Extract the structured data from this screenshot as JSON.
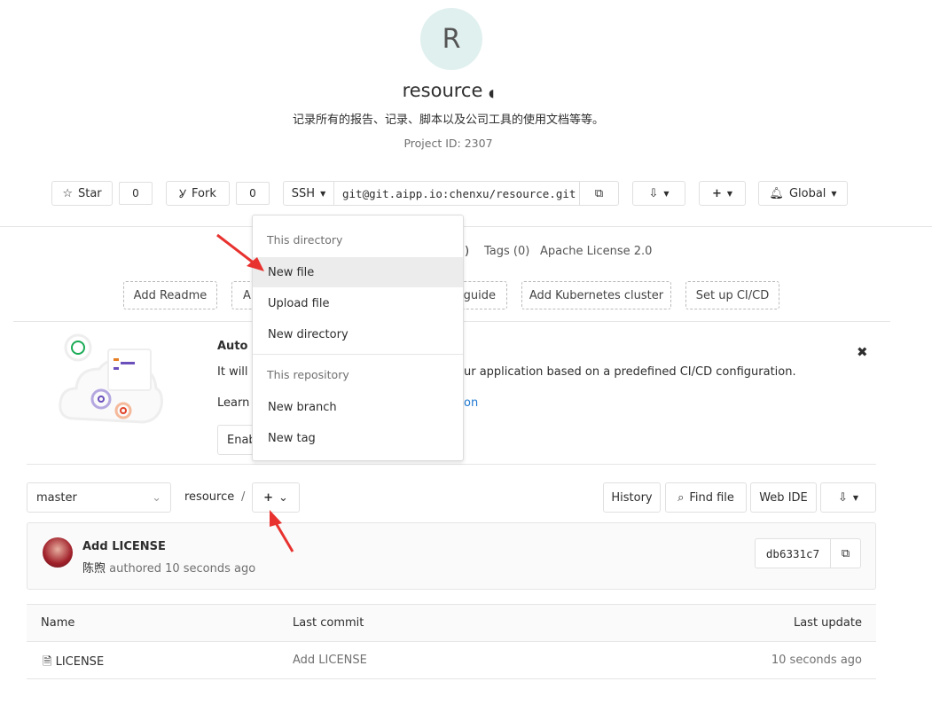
{
  "project": {
    "avatar_letter": "R",
    "name": "resource",
    "description": "记录所有的报告、记录、脚本以及公司工具的使用文档等等。",
    "project_id": "Project ID: 2307"
  },
  "actions": {
    "star": "Star",
    "star_count": "0",
    "fork": "Fork",
    "fork_count": "0",
    "protocol": "SSH",
    "clone_url": "git@git.aipp.io:chenxu/resource.git",
    "notification": "Global"
  },
  "stats": {
    "partial": ")",
    "tags": "Tags (0)",
    "license": "Apache License 2.0"
  },
  "quick_buttons": [
    "Add Readme",
    "A",
    "guide",
    "Add Kubernetes cluster",
    "Set up CI/CD"
  ],
  "banner": {
    "title": "Auto D",
    "line1_start": "It will a",
    "line1_end": "ur application based on a predefined CI/CD configuration.",
    "learn": "Learn",
    "learn_link_end": "on",
    "enable": "Enab"
  },
  "dropdown": {
    "header1": "This directory",
    "items1": [
      "New file",
      "Upload file",
      "New directory"
    ],
    "header2": "This repository",
    "items2": [
      "New branch",
      "New tag"
    ],
    "active": "New file"
  },
  "repo_nav": {
    "branch": "master",
    "path": "resource",
    "separator": "/",
    "history": "History",
    "find_file": "Find file",
    "web_ide": "Web IDE"
  },
  "commit": {
    "message": "Add LICENSE",
    "author": "陈煦",
    "meta": "authored 10 seconds ago",
    "sha": "db6331c7"
  },
  "table": {
    "headers": [
      "Name",
      "Last commit",
      "Last update"
    ],
    "rows": [
      {
        "name": "LICENSE",
        "commit": "Add LICENSE",
        "updated": "10 seconds ago"
      }
    ]
  },
  "colors": {
    "link": "#1f78d1",
    "arrow": "#e8322f",
    "avatar_bg": "#e0f0ee"
  }
}
